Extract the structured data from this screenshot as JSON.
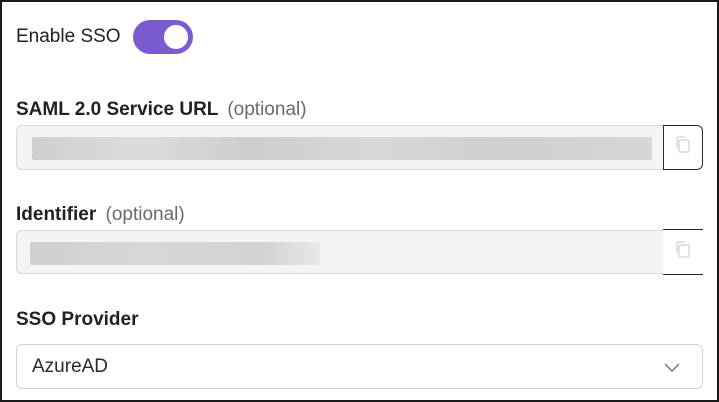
{
  "sso": {
    "toggle_label": "Enable SSO",
    "enabled": true,
    "toggle_color": "#7a5cd0"
  },
  "saml_url": {
    "label": "SAML 2.0 Service URL",
    "optional": "(optional)",
    "copy_icon": "copy-icon"
  },
  "identifier": {
    "label": "Identifier",
    "optional": "(optional)",
    "copy_icon": "copy-icon"
  },
  "provider": {
    "label": "SSO Provider",
    "value": "AzureAD",
    "dropdown_icon": "chevron-down-icon"
  }
}
